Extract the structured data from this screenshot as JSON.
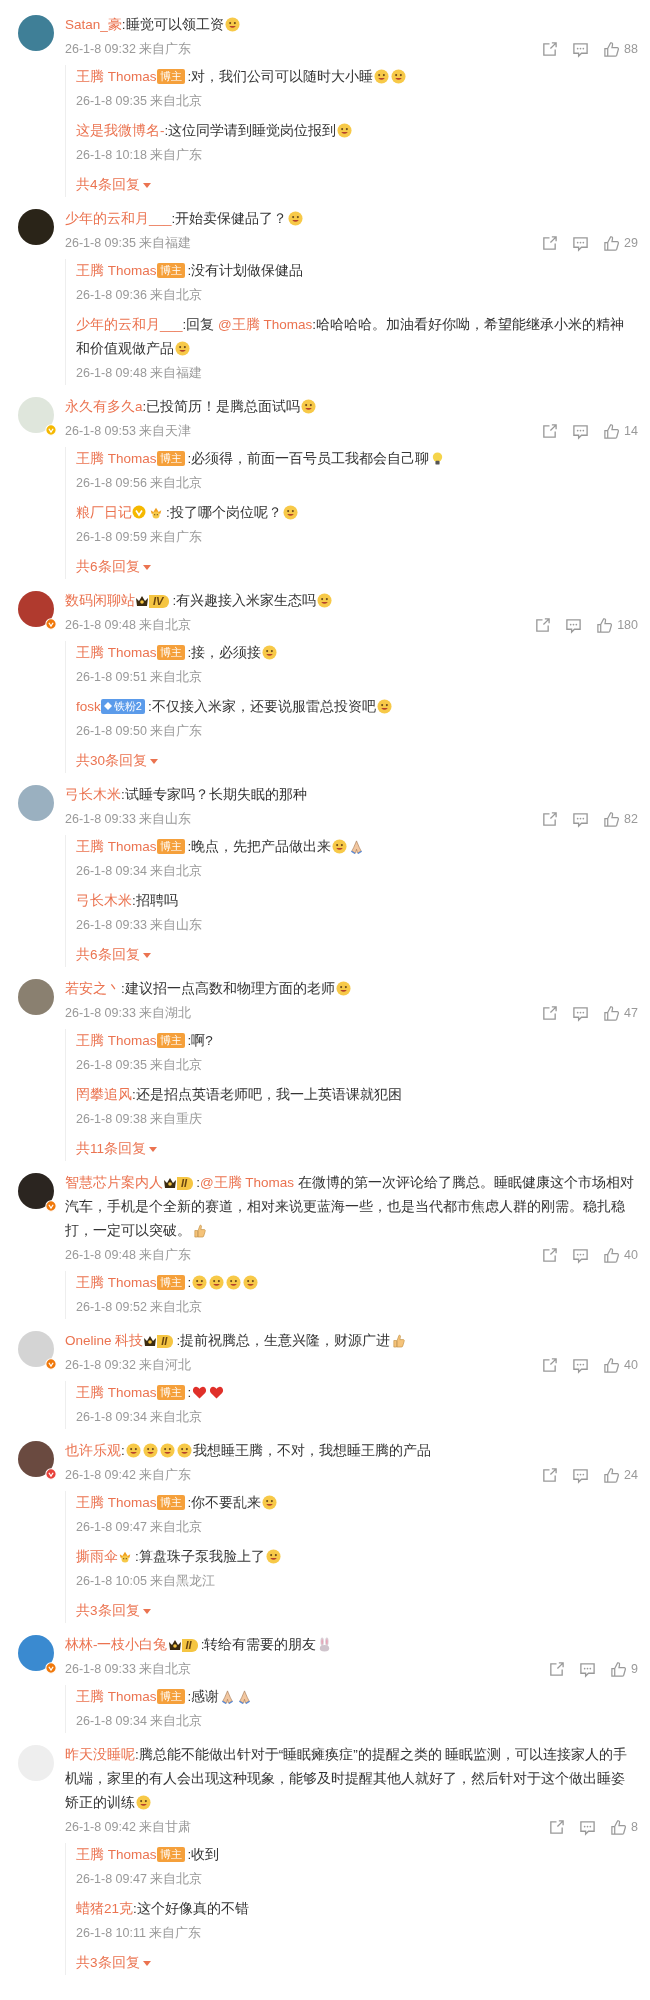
{
  "comments": [
    {
      "name": "Satan_豪",
      "avatar": {
        "color": "#3f7f97"
      },
      "content": [
        {
          "kind": "text",
          "text": ":睡觉可以领工资"
        },
        {
          "kind": "face"
        }
      ],
      "meta": "26-1-8 09:32 来自广东",
      "likes": "88",
      "replies": [
        {
          "name": "王腾 Thomas",
          "badges": [
            {
              "kind": "host",
              "text": "博主"
            }
          ],
          "content": [
            {
              "kind": "text",
              "text": ":对，我们公司可以随时大小睡"
            },
            {
              "kind": "face"
            },
            {
              "kind": "face"
            }
          ],
          "meta": "26-1-8 09:35 来自北京"
        },
        {
          "name": "这是我微博名-",
          "content": [
            {
              "kind": "text",
              "text": ":这位同学请到睡觉岗位报到"
            },
            {
              "kind": "face"
            }
          ],
          "meta": "26-1-8 10:18 来自广东"
        }
      ],
      "more": "共4条回复"
    },
    {
      "name": "少年的云和月___",
      "avatar": {
        "color": "#2a2418"
      },
      "content": [
        {
          "kind": "text",
          "text": ":开始卖保健品了？"
        },
        {
          "kind": "face"
        }
      ],
      "meta": "26-1-8 09:35 来自福建",
      "likes": "29",
      "replies": [
        {
          "name": "王腾 Thomas",
          "badges": [
            {
              "kind": "host",
              "text": "博主"
            }
          ],
          "content": [
            {
              "kind": "text",
              "text": ":没有计划做保健品"
            }
          ],
          "meta": "26-1-8 09:36 来自北京"
        },
        {
          "name": "少年的云和月___",
          "content": [
            {
              "kind": "text",
              "text": ":回复 "
            },
            {
              "kind": "mention",
              "text": "@王腾 Thomas"
            },
            {
              "kind": "text",
              "text": ":哈哈哈哈。加油看好你呦，希望能继承小米的精神和价值观做产品"
            },
            {
              "kind": "face"
            }
          ],
          "meta": "26-1-8 09:48 来自福建"
        }
      ]
    },
    {
      "name": "永久有多久a",
      "avatar": {
        "color": "#dfe6dc"
      },
      "verified": {
        "color": "#f5b800"
      },
      "content": [
        {
          "kind": "text",
          "text": ":已投简历！是腾总面试吗"
        },
        {
          "kind": "face"
        }
      ],
      "meta": "26-1-8 09:53 来自天津",
      "likes": "14",
      "replies": [
        {
          "name": "王腾 Thomas",
          "badges": [
            {
              "kind": "host",
              "text": "博主"
            }
          ],
          "content": [
            {
              "kind": "text",
              "text": ":必须得，前面一百号员工我都会自己聊"
            },
            {
              "kind": "bulb"
            }
          ],
          "meta": "26-1-8 09:56 来自北京"
        },
        {
          "name": "粮厂日记",
          "badges": [
            {
              "kind": "verified"
            },
            {
              "kind": "medal"
            }
          ],
          "content": [
            {
              "kind": "text",
              "text": ":投了哪个岗位呢？"
            },
            {
              "kind": "face"
            }
          ],
          "meta": "26-1-8 09:59 来自广东"
        }
      ],
      "more": "共6条回复"
    },
    {
      "name": "数码闲聊站",
      "avatar": {
        "color": "#b03a2e"
      },
      "verified": {
        "color": "#f0780a"
      },
      "badges": [
        {
          "kind": "vip",
          "text": "IV"
        }
      ],
      "content": [
        {
          "kind": "text",
          "text": ":有兴趣接入米家生态吗"
        },
        {
          "kind": "face"
        }
      ],
      "meta": "26-1-8 09:48 来自北京",
      "likes": "180",
      "replies": [
        {
          "name": "王腾 Thomas",
          "badges": [
            {
              "kind": "host",
              "text": "博主"
            }
          ],
          "content": [
            {
              "kind": "text",
              "text": ":接，必须接"
            },
            {
              "kind": "face"
            }
          ],
          "meta": "26-1-8 09:51 来自北京"
        },
        {
          "name": "fosk",
          "badges": [
            {
              "kind": "fan",
              "text": "铁粉2"
            }
          ],
          "content": [
            {
              "kind": "text",
              "text": ":不仅接入米家，还要说服雷总投资吧"
            },
            {
              "kind": "face"
            }
          ],
          "meta": "26-1-8 09:50 来自广东"
        }
      ],
      "more": "共30条回复"
    },
    {
      "name": "弓长木米",
      "avatar": {
        "color": "#9ab0c0"
      },
      "content": [
        {
          "kind": "text",
          "text": ":试睡专家吗？长期失眠的那种"
        }
      ],
      "meta": "26-1-8 09:33 来自山东",
      "likes": "82",
      "replies": [
        {
          "name": "王腾 Thomas",
          "badges": [
            {
              "kind": "host",
              "text": "博主"
            }
          ],
          "content": [
            {
              "kind": "text",
              "text": ":晚点，先把产品做出来"
            },
            {
              "kind": "face"
            },
            {
              "kind": "hands"
            }
          ],
          "meta": "26-1-8 09:34 来自北京"
        },
        {
          "name": "弓长木米",
          "content": [
            {
              "kind": "text",
              "text": ":招聘吗"
            }
          ],
          "meta": "26-1-8 09:33 来自山东"
        }
      ],
      "more": "共6条回复"
    },
    {
      "name": "若安之丶",
      "avatar": {
        "color": "#8a8070"
      },
      "content": [
        {
          "kind": "text",
          "text": ":建议招一点高数和物理方面的老师"
        },
        {
          "kind": "face"
        }
      ],
      "meta": "26-1-8 09:33 来自湖北",
      "likes": "47",
      "replies": [
        {
          "name": "王腾 Thomas",
          "badges": [
            {
              "kind": "host",
              "text": "博主"
            }
          ],
          "content": [
            {
              "kind": "text",
              "text": ":啊?"
            }
          ],
          "meta": "26-1-8 09:35 来自北京"
        },
        {
          "name": "罔攀追风",
          "content": [
            {
              "kind": "text",
              "text": ":还是招点英语老师吧，我一上英语课就犯困"
            }
          ],
          "meta": "26-1-8 09:38 来自重庆"
        }
      ],
      "more": "共11条回复"
    },
    {
      "name": "智慧芯片案内人",
      "avatar": {
        "color": "#2b2520"
      },
      "verified": {
        "color": "#f0780a"
      },
      "badges": [
        {
          "kind": "vip",
          "text": "II"
        }
      ],
      "content": [
        {
          "kind": "text",
          "text": ":"
        },
        {
          "kind": "mention",
          "text": "@王腾 Thomas"
        },
        {
          "kind": "text",
          "text": " 在微博的第一次评论给了腾总。睡眠健康这个市场相对汽车，手机是个全新的赛道，相对来说更蓝海一些，也是当代都市焦虑人群的刚需。稳扎稳打，一定可以突破。"
        },
        {
          "kind": "thumb"
        }
      ],
      "meta": "26-1-8 09:48 来自广东",
      "likes": "40",
      "replies": [
        {
          "name": "王腾 Thomas",
          "badges": [
            {
              "kind": "host",
              "text": "博主"
            }
          ],
          "content": [
            {
              "kind": "text",
              "text": ":"
            },
            {
              "kind": "face"
            },
            {
              "kind": "face"
            },
            {
              "kind": "face"
            },
            {
              "kind": "face"
            }
          ],
          "meta": "26-1-8 09:52 来自北京"
        }
      ]
    },
    {
      "name": "Oneline 科技",
      "avatar": {
        "color": "#d4d4d4"
      },
      "verified": {
        "color": "#f0780a"
      },
      "badges": [
        {
          "kind": "vip",
          "text": "II"
        }
      ],
      "content": [
        {
          "kind": "text",
          "text": ":提前祝腾总，生意兴隆，财源广进"
        },
        {
          "kind": "thumb"
        }
      ],
      "meta": "26-1-8 09:32 来自河北",
      "likes": "40",
      "replies": [
        {
          "name": "王腾 Thomas",
          "badges": [
            {
              "kind": "host",
              "text": "博主"
            }
          ],
          "content": [
            {
              "kind": "text",
              "text": ":"
            },
            {
              "kind": "heart"
            },
            {
              "kind": "heart"
            }
          ],
          "meta": "26-1-8 09:34 来自北京"
        }
      ]
    },
    {
      "name": "也许乐观",
      "avatar": {
        "color": "#6a4a40"
      },
      "verified": {
        "color": "#e8413a"
      },
      "content": [
        {
          "kind": "text",
          "text": ":"
        },
        {
          "kind": "face"
        },
        {
          "kind": "face"
        },
        {
          "kind": "face"
        },
        {
          "kind": "face"
        },
        {
          "kind": "text",
          "text": "我想睡王腾，不对，我想睡王腾的产品"
        }
      ],
      "meta": "26-1-8 09:42 来自广东",
      "likes": "24",
      "replies": [
        {
          "name": "王腾 Thomas",
          "badges": [
            {
              "kind": "host",
              "text": "博主"
            }
          ],
          "content": [
            {
              "kind": "text",
              "text": ":你不要乱来"
            },
            {
              "kind": "face"
            }
          ],
          "meta": "26-1-8 09:47 来自北京"
        },
        {
          "name": "撕雨伞",
          "badges": [
            {
              "kind": "medal"
            }
          ],
          "content": [
            {
              "kind": "text",
              "text": ":算盘珠子泵我脸上了"
            },
            {
              "kind": "face"
            }
          ],
          "meta": "26-1-8 10:05 来自黑龙江"
        }
      ],
      "more": "共3条回复"
    },
    {
      "name": "林林-一枝小白兔",
      "avatar": {
        "color": "#3a8ad0"
      },
      "verified": {
        "color": "#f0780a"
      },
      "badges": [
        {
          "kind": "vip",
          "text": "II"
        }
      ],
      "content": [
        {
          "kind": "text",
          "text": ":转给有需要的朋友"
        },
        {
          "kind": "bunny"
        }
      ],
      "meta": "26-1-8 09:33 来自北京",
      "likes": "9",
      "replies": [
        {
          "name": "王腾 Thomas",
          "badges": [
            {
              "kind": "host",
              "text": "博主"
            }
          ],
          "content": [
            {
              "kind": "text",
              "text": ":感谢"
            },
            {
              "kind": "hands"
            },
            {
              "kind": "hands"
            }
          ],
          "meta": "26-1-8 09:34 来自北京"
        }
      ]
    },
    {
      "name": "昨天没睡呢",
      "avatar": {
        "color": "#eeeeee"
      },
      "content": [
        {
          "kind": "text",
          "text": ":腾总能不能做出针对于“睡眠瘫痪症”的提醒之类的 睡眠监测，可以连接家人的手机端，家里的有人会出现这种现象，能够及时提醒其他人就好了，然后针对于这个做出睡姿矫正的训练"
        },
        {
          "kind": "face"
        }
      ],
      "meta": "26-1-8 09:42 来自甘肃",
      "likes": "8",
      "replies": [
        {
          "name": "王腾 Thomas",
          "badges": [
            {
              "kind": "host",
              "text": "博主"
            }
          ],
          "content": [
            {
              "kind": "text",
              "text": ":收到"
            }
          ],
          "meta": "26-1-8 09:47 来自北京"
        },
        {
          "name": "蜡猪21克",
          "content": [
            {
              "kind": "text",
              "text": ":这个好像真的不错"
            }
          ],
          "meta": "26-1-8 10:11 来自广东"
        }
      ],
      "more": "共3条回复"
    }
  ]
}
